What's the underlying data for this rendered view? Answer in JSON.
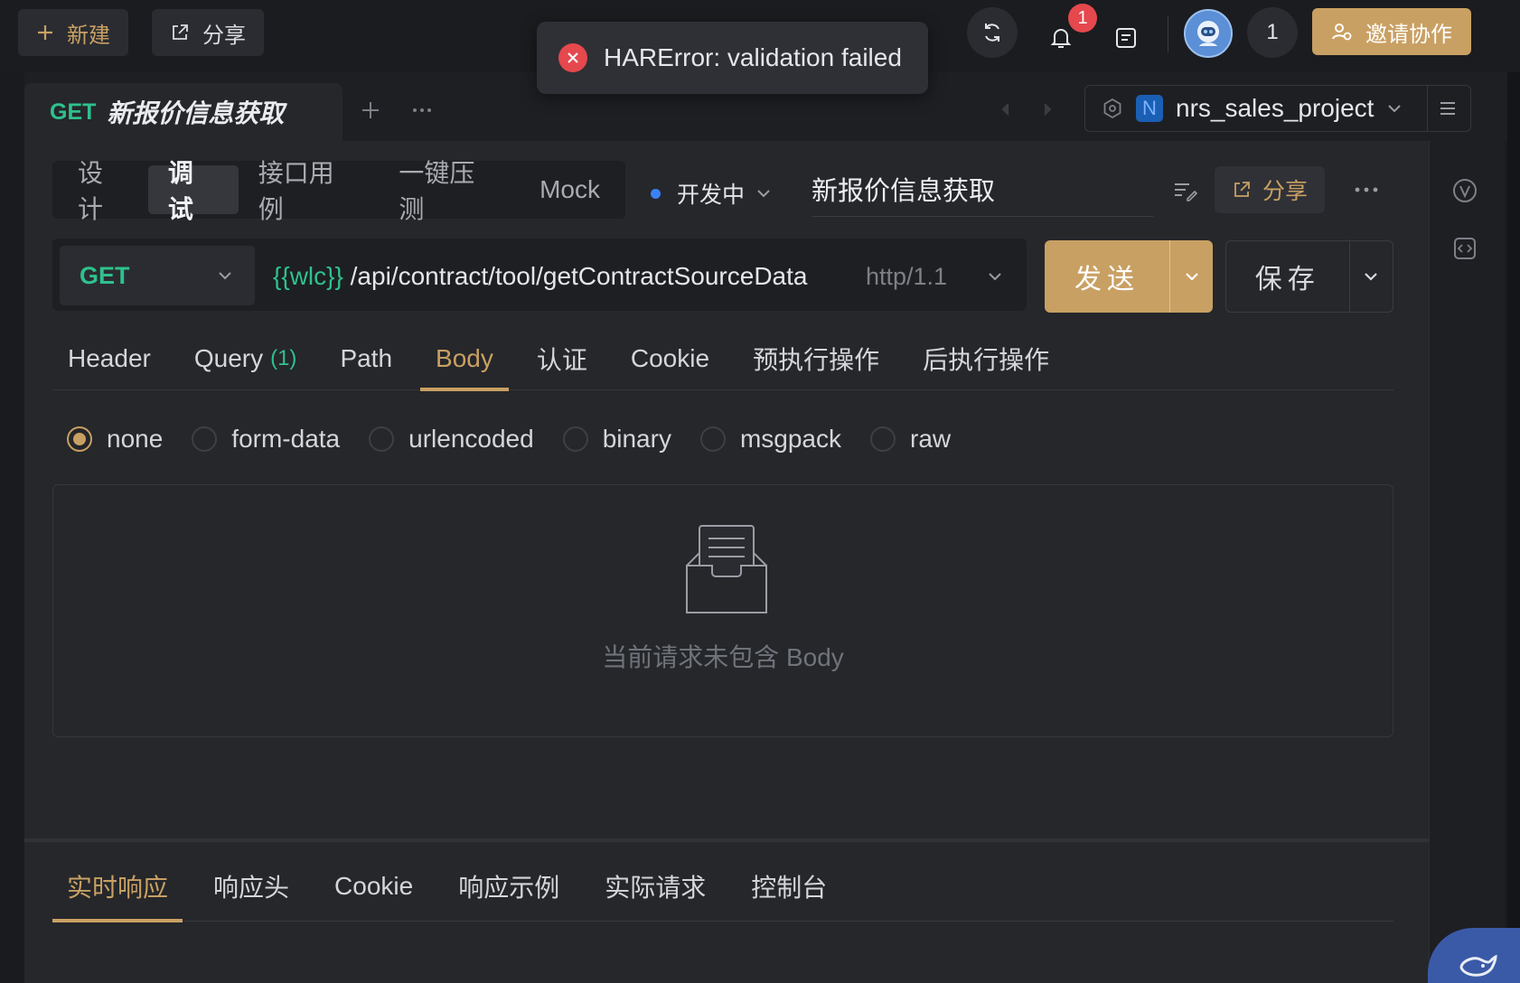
{
  "topbar": {
    "new_label": "新建",
    "share_label": "分享",
    "notification_count": "1",
    "user_count": "1",
    "invite_label": "邀请协作"
  },
  "toast": {
    "message": "HARError: validation failed"
  },
  "tab": {
    "method": "GET",
    "title": "新报价信息获取"
  },
  "project": {
    "badge": "N",
    "name": "nrs_sales_project"
  },
  "mode_tabs": [
    "设计",
    "调试",
    "接口用例",
    "一键压测",
    "Mock"
  ],
  "status": {
    "label": "开发中"
  },
  "api_name": "新报价信息获取",
  "share_btn": "分享",
  "request": {
    "method": "GET",
    "url_var": "{{wlc}}",
    "url_path": " /api/contract/tool/getContractSourceData",
    "protocol": "http/1.1",
    "send_label": "发送",
    "save_label": "保存"
  },
  "req_tabs": {
    "header": "Header",
    "query": "Query",
    "query_count": "(1)",
    "path": "Path",
    "body": "Body",
    "auth": "认证",
    "cookie": "Cookie",
    "pre": "预执行操作",
    "post": "后执行操作"
  },
  "body_types": [
    "none",
    "form-data",
    "urlencoded",
    "binary",
    "msgpack",
    "raw"
  ],
  "empty_message": "当前请求未包含 Body",
  "response_tabs": [
    "实时响应",
    "响应头",
    "Cookie",
    "响应示例",
    "实际请求",
    "控制台"
  ],
  "colors": {
    "accent": "#c9a063",
    "get_method": "#2fc18c",
    "error": "#e5484d"
  }
}
